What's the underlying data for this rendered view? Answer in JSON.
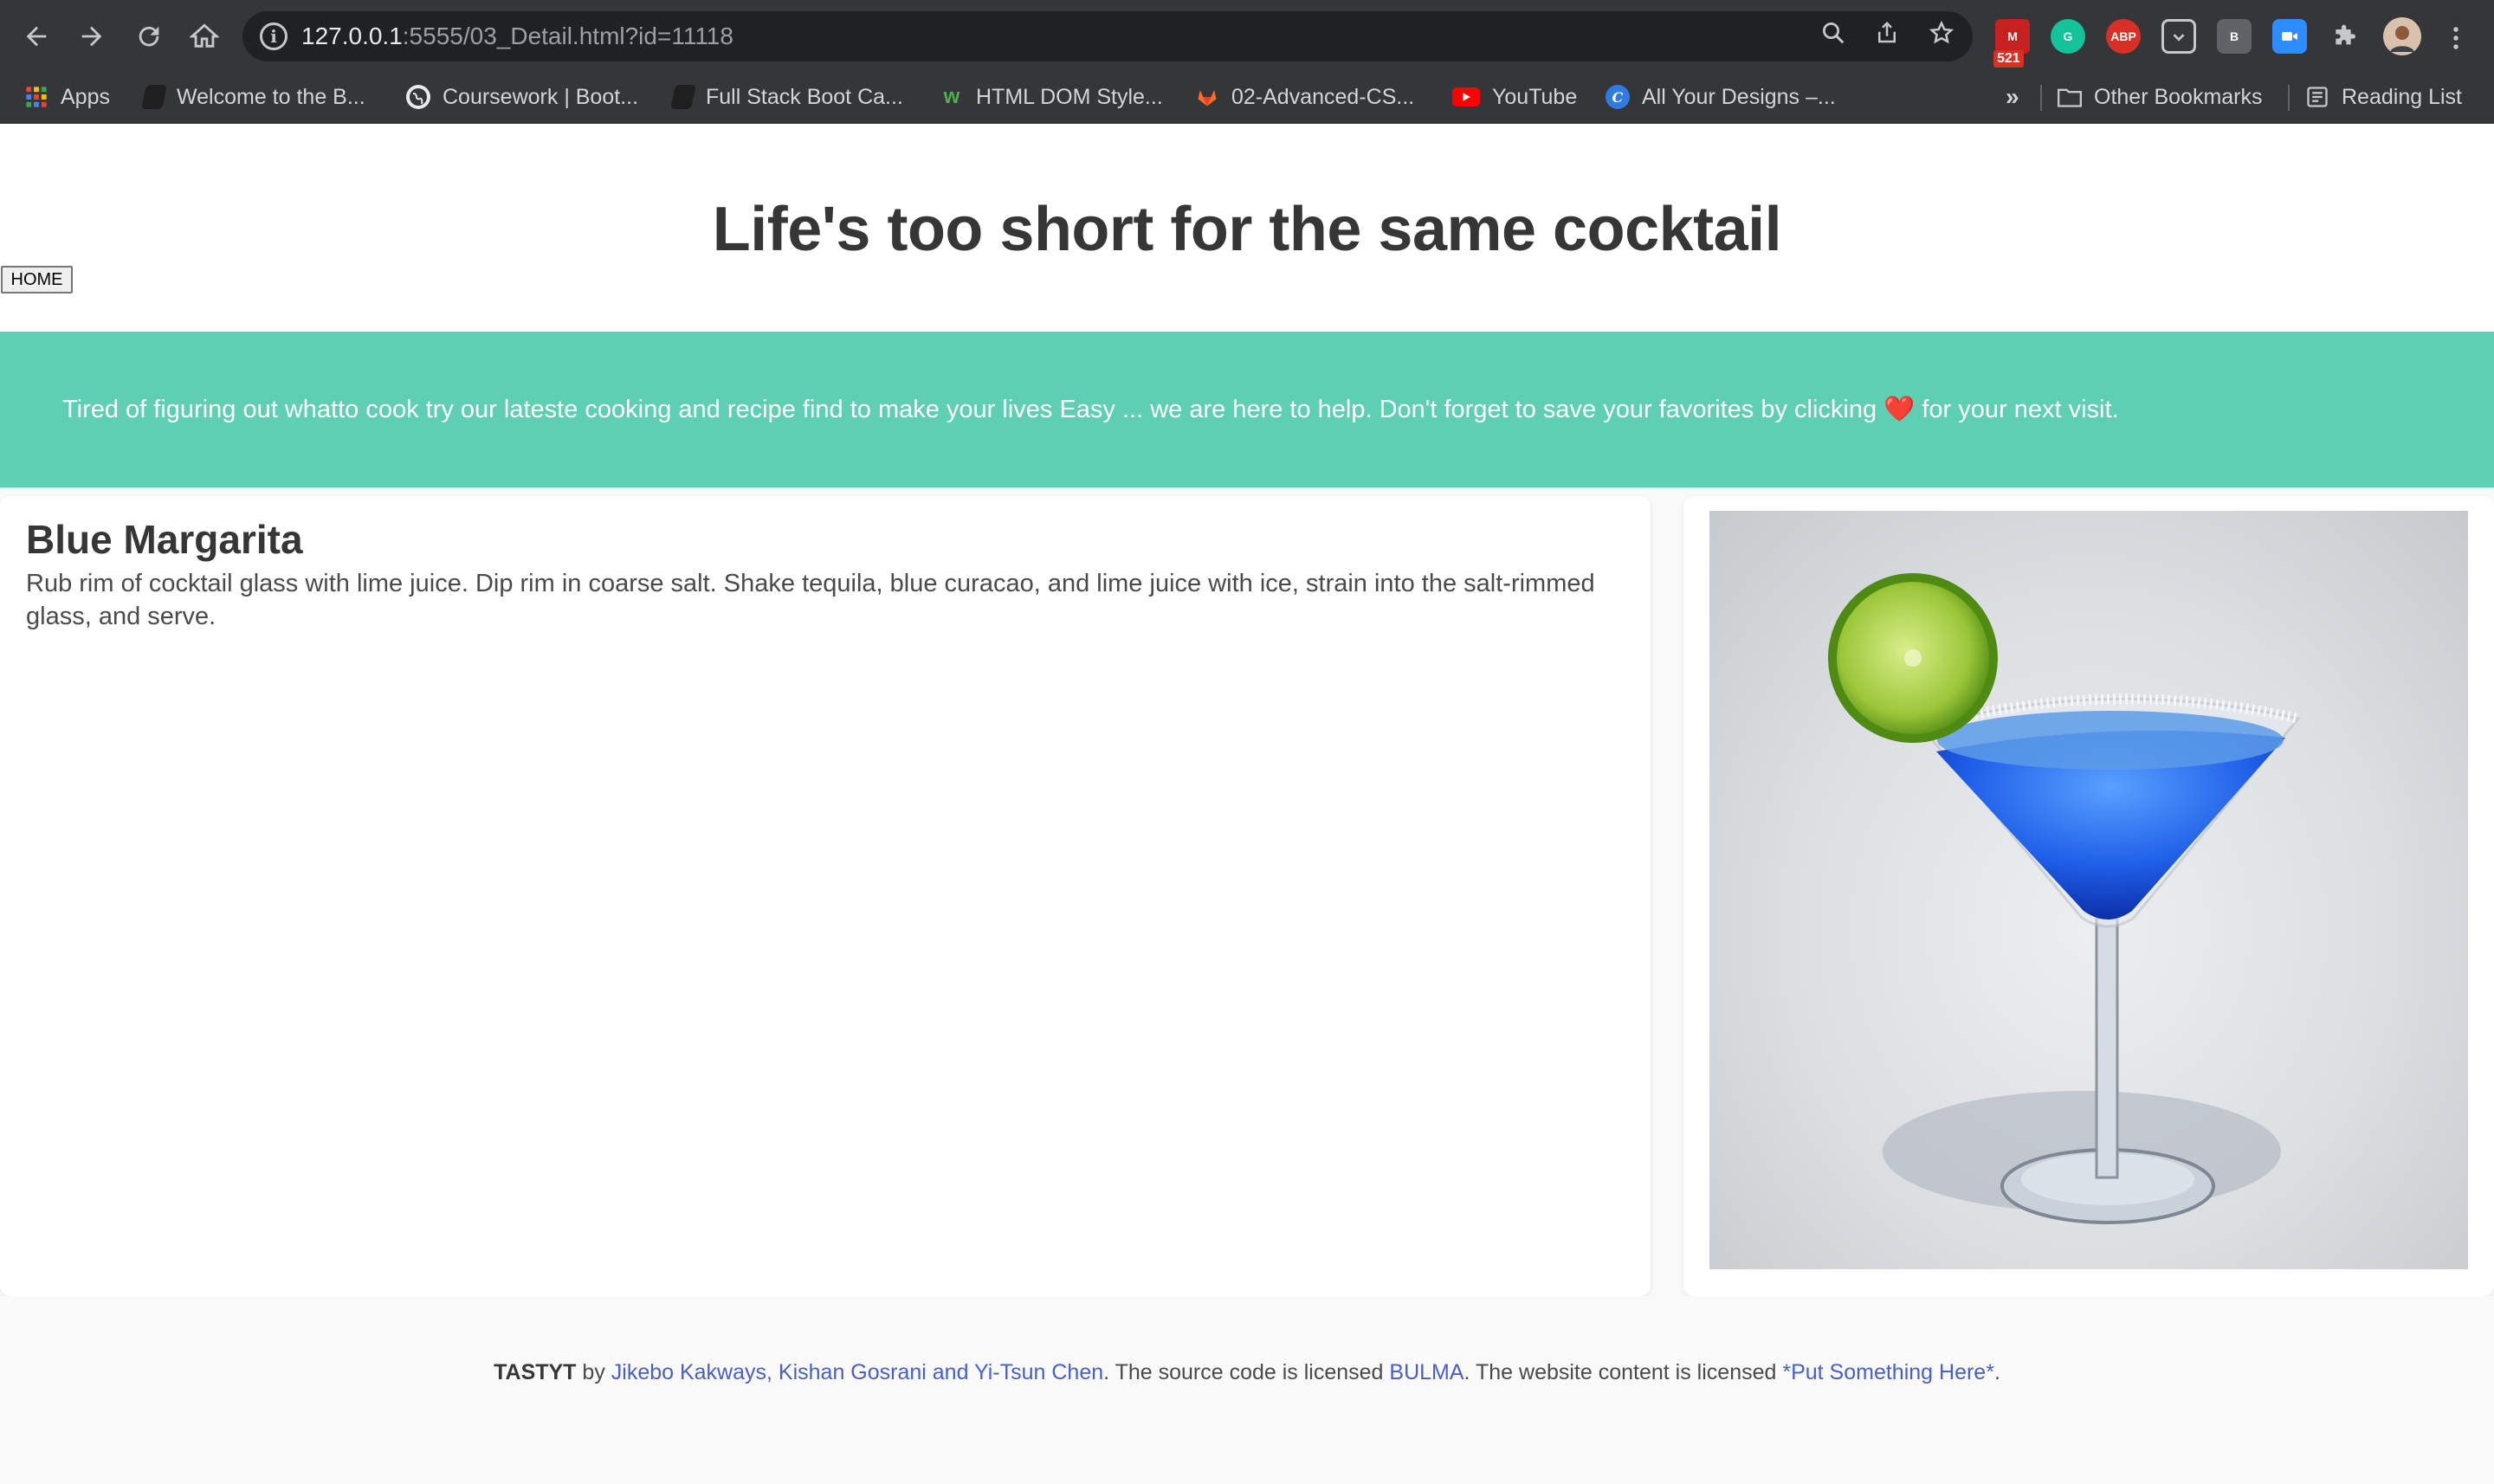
{
  "browser": {
    "url_host": "127.0.0.1",
    "url_rest": ":5555/03_Detail.html?id=11118",
    "mail_badge": "521",
    "bookmarks": [
      {
        "label": "Apps",
        "icon": "apps-grid-icon"
      },
      {
        "label": "Welcome to the B...",
        "icon": "book-icon"
      },
      {
        "label": "Coursework | Boot...",
        "icon": "globe-icon"
      },
      {
        "label": "Full Stack Boot Ca...",
        "icon": "book-icon"
      },
      {
        "label": "HTML DOM Style...",
        "icon": "w3-icon"
      },
      {
        "label": "02-Advanced-CS...",
        "icon": "gitlab-icon"
      },
      {
        "label": "YouTube",
        "icon": "youtube-icon"
      },
      {
        "label": "All Your Designs –...",
        "icon": "canva-icon"
      }
    ],
    "overflow_label": "»",
    "other_bookmarks": "Other Bookmarks",
    "reading_list": "Reading List"
  },
  "header": {
    "title": "Life's too short for the same cocktail",
    "home_button": "HOME"
  },
  "banner": {
    "text_before": "Tired of figuring out whatto cook try our lateste cooking and recipe find to make your lives Easy ... we are here to help. Don't forget to save your favorites by clicking",
    "heart": "❤️",
    "text_after": " for your next visit."
  },
  "drink": {
    "name": "Blue Margarita",
    "instructions": "Rub rim of cocktail glass with lime juice. Dip rim in coarse salt. Shake tequila, blue curacao, and lime juice with ice, strain into the salt-rimmed glass, and serve."
  },
  "footer": {
    "brand": "TASTYT",
    "by": " by ",
    "authors": "Jikebo Kakways, Kishan Gosrani and Yi-Tsun Chen",
    "mid1": ". The source code is licensed ",
    "license_link": "BULMA",
    "mid2": ". The website content is licensed ",
    "content_link": "*Put Something Here*",
    "end": "."
  },
  "colors": {
    "banner": "#5fcfb3",
    "chrome": "#35363a",
    "link": "#485fc7"
  }
}
